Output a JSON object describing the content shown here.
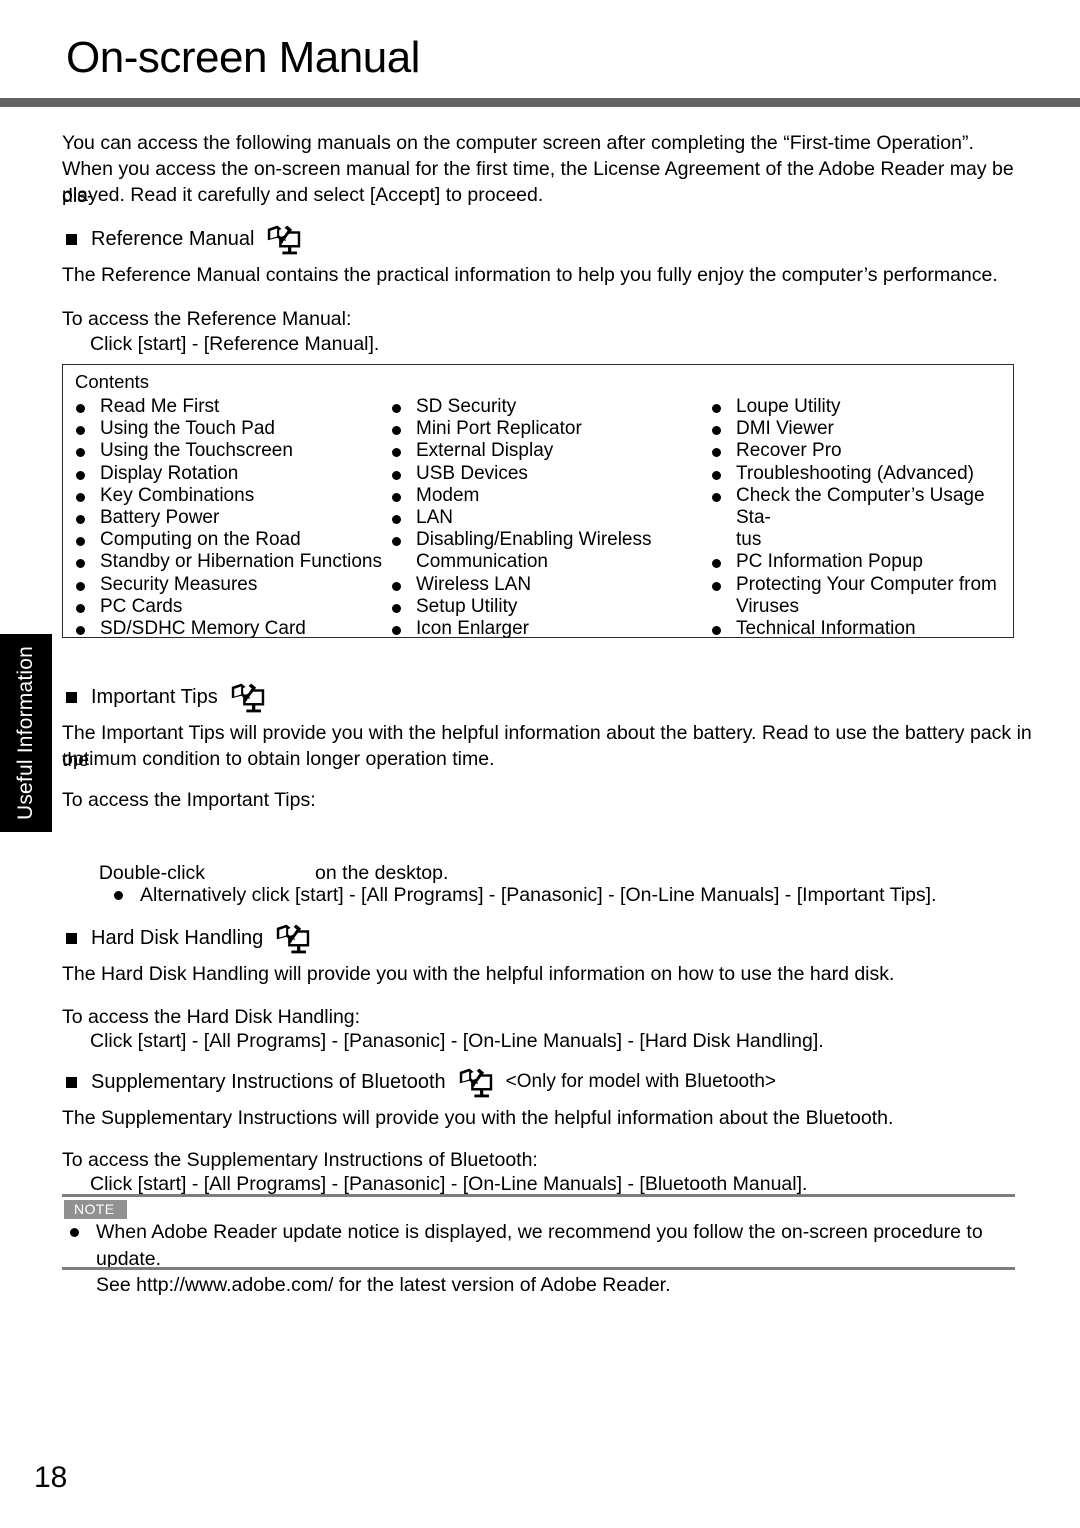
{
  "page": {
    "title": "On-screen Manual",
    "number": "18",
    "side_tab_label": "Useful Information"
  },
  "intro": {
    "line1": "You can access the following manuals on the computer screen after completing the “First-time Operation”.",
    "line2": "When you access the on-screen manual for the first time, the License Agreement of the Adobe Reader may be dis-",
    "line3": "played. Read it carefully and select [Accept] to proceed."
  },
  "sections": {
    "reference_manual": {
      "heading": "Reference Manual",
      "icon": "on-screen-manual-icon",
      "description": "The Reference Manual contains the practical information to help you fully enjoy the computer’s performance.",
      "access_label": "To access the Reference Manual:",
      "access_step": "Click [start] - [Reference Manual]."
    },
    "important_tips": {
      "heading": "Important Tips",
      "icon": "on-screen-manual-icon",
      "description_line1": "The Important Tips will provide you with the helpful information about the battery. Read to use the battery pack in the",
      "description_line2": "optimum condition to obtain longer operation time.",
      "access_label": "To access the Important Tips:",
      "double_click_prefix": "Double-click",
      "double_click_suffix": "on the desktop.",
      "alternative": "Alternatively click [start] - [All Programs] - [Panasonic] - [On-Line Manuals] - [Important Tips]."
    },
    "hard_disk_handling": {
      "heading": "Hard Disk Handling",
      "icon": "on-screen-manual-icon",
      "description": "The Hard Disk Handling will provide you with the helpful information on how to use the hard disk.",
      "access_label": "To access the Hard Disk Handling:",
      "access_step": "Click [start] - [All Programs] - [Panasonic] - [On-Line Manuals] - [Hard Disk Handling]."
    },
    "bluetooth": {
      "heading": "Supplementary Instructions of Bluetooth",
      "icon": "on-screen-manual-icon",
      "note": "<Only for model with Bluetooth>",
      "description": "The Supplementary Instructions will provide you with the helpful information about the Bluetooth.",
      "access_label": "To access the Supplementary Instructions of Bluetooth:",
      "access_step": "Click [start] - [All Programs] - [Panasonic] - [On-Line Manuals] - [Bluetooth Manual]."
    }
  },
  "contents_box": {
    "label": "Contents",
    "column1": [
      {
        "text": "Read Me First",
        "bullet": true
      },
      {
        "text": "Using the Touch Pad",
        "bullet": true
      },
      {
        "text": "Using the Touchscreen",
        "bullet": true
      },
      {
        "text": "Display Rotation",
        "bullet": true
      },
      {
        "text": "Key Combinations",
        "bullet": true
      },
      {
        "text": "Battery Power",
        "bullet": true
      },
      {
        "text": "Computing on the Road",
        "bullet": true
      },
      {
        "text": "Standby or Hibernation Functions",
        "bullet": true
      },
      {
        "text": "Security Measures",
        "bullet": true
      },
      {
        "text": "PC Cards",
        "bullet": true
      },
      {
        "text": "SD/SDHC Memory Card",
        "bullet": true
      }
    ],
    "column2": [
      {
        "text": "SD Security",
        "bullet": true
      },
      {
        "text": "Mini Port Replicator",
        "bullet": true
      },
      {
        "text": "External Display",
        "bullet": true
      },
      {
        "text": "USB Devices",
        "bullet": true
      },
      {
        "text": "Modem",
        "bullet": true
      },
      {
        "text": "LAN",
        "bullet": true
      },
      {
        "text": "Disabling/Enabling Wireless",
        "bullet": true
      },
      {
        "text": "Communication",
        "bullet": false
      },
      {
        "text": "Wireless LAN",
        "bullet": true
      },
      {
        "text": "Setup Utility",
        "bullet": true
      },
      {
        "text": "Icon Enlarger",
        "bullet": true
      }
    ],
    "column3": [
      {
        "text": "Loupe Utility",
        "bullet": true
      },
      {
        "text": "DMI Viewer",
        "bullet": true
      },
      {
        "text": "Recover Pro",
        "bullet": true
      },
      {
        "text": "Troubleshooting (Advanced)",
        "bullet": true
      },
      {
        "text": "Check the Computer’s Usage Sta-",
        "bullet": true
      },
      {
        "text": "tus",
        "bullet": false
      },
      {
        "text": "PC Information Popup",
        "bullet": true
      },
      {
        "text": "Protecting Your Computer from",
        "bullet": true
      },
      {
        "text": "Viruses",
        "bullet": false
      },
      {
        "text": "Technical Information",
        "bullet": true
      }
    ]
  },
  "note": {
    "label": "NOTE",
    "line1": "When Adobe Reader update notice is displayed, we recommend you follow the on-screen procedure to update.",
    "line2": "See http://www.adobe.com/ for the latest version of Adobe Reader."
  },
  "colors": {
    "header_rule": "#636363",
    "note_label_bg": "#919191",
    "note_rule": "#7d7d7d",
    "side_tab_bg": "#000000"
  }
}
